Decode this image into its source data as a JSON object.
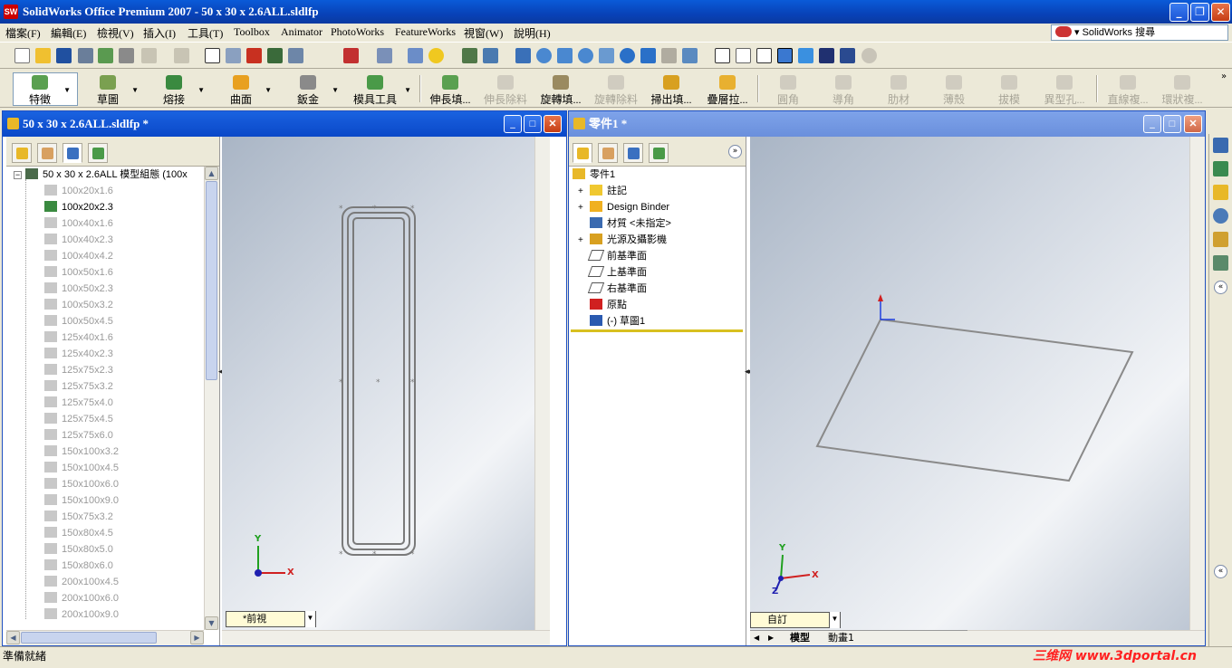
{
  "app": {
    "title": "SolidWorks Office Premium 2007 - 50 x 30 x 2.6ALL.sldlfp",
    "icon_label": "SW"
  },
  "menu": [
    "檔案(F)",
    "編輯(E)",
    "檢視(V)",
    "插入(I)",
    "工具(T)",
    "Toolbox",
    "Animator",
    "PhotoWorks",
    "FeatureWorks",
    "視窗(W)",
    "說明(H)"
  ],
  "search": {
    "label": "SolidWorks 搜尋"
  },
  "command_manager": {
    "groups": [
      "特徵",
      "草圖",
      "熔接",
      "曲面",
      "鈑金",
      "模具工具"
    ],
    "features": [
      {
        "label": "伸長填...",
        "enabled": true
      },
      {
        "label": "伸長除料",
        "enabled": false
      },
      {
        "label": "旋轉填...",
        "enabled": true
      },
      {
        "label": "旋轉除料",
        "enabled": false
      },
      {
        "label": "掃出填...",
        "enabled": true
      },
      {
        "label": "疊層拉...",
        "enabled": true
      },
      {
        "label": "圓角",
        "enabled": false
      },
      {
        "label": "導角",
        "enabled": false
      },
      {
        "label": "肋材",
        "enabled": false
      },
      {
        "label": "薄殼",
        "enabled": false
      },
      {
        "label": "拔模",
        "enabled": false
      },
      {
        "label": "異型孔...",
        "enabled": false
      },
      {
        "label": "直線複...",
        "enabled": false
      },
      {
        "label": "環狀複...",
        "enabled": false
      }
    ]
  },
  "left_doc": {
    "title": "50 x 30 x 2.6ALL.sldlfp *",
    "root": "50 x 30 x 2.6ALL 模型組態 (100x",
    "configs": [
      {
        "name": "100x20x1.6",
        "active": false
      },
      {
        "name": "100x20x2.3",
        "active": true
      },
      {
        "name": "100x40x1.6",
        "active": false
      },
      {
        "name": "100x40x2.3",
        "active": false
      },
      {
        "name": "100x40x4.2",
        "active": false
      },
      {
        "name": "100x50x1.6",
        "active": false
      },
      {
        "name": "100x50x2.3",
        "active": false
      },
      {
        "name": "100x50x3.2",
        "active": false
      },
      {
        "name": "100x50x4.5",
        "active": false
      },
      {
        "name": "125x40x1.6",
        "active": false
      },
      {
        "name": "125x40x2.3",
        "active": false
      },
      {
        "name": "125x75x2.3",
        "active": false
      },
      {
        "name": "125x75x3.2",
        "active": false
      },
      {
        "name": "125x75x4.0",
        "active": false
      },
      {
        "name": "125x75x4.5",
        "active": false
      },
      {
        "name": "125x75x6.0",
        "active": false
      },
      {
        "name": "150x100x3.2",
        "active": false
      },
      {
        "name": "150x100x4.5",
        "active": false
      },
      {
        "name": "150x100x6.0",
        "active": false
      },
      {
        "name": "150x100x9.0",
        "active": false
      },
      {
        "name": "150x75x3.2",
        "active": false
      },
      {
        "name": "150x80x4.5",
        "active": false
      },
      {
        "name": "150x80x5.0",
        "active": false
      },
      {
        "name": "150x80x6.0",
        "active": false
      },
      {
        "name": "200x100x4.5",
        "active": false
      },
      {
        "name": "200x100x6.0",
        "active": false
      },
      {
        "name": "200x100x9.0",
        "active": false
      }
    ],
    "view_tab": "*前視"
  },
  "right_doc": {
    "title": "零件1 *",
    "tree": [
      {
        "label": "零件1",
        "expand": false,
        "icon": "part-icon"
      },
      {
        "label": "註記",
        "expand": true,
        "icon": "annotations-icon"
      },
      {
        "label": "Design Binder",
        "expand": true,
        "icon": "binder-icon"
      },
      {
        "label": "材質 <未指定>",
        "expand": false,
        "icon": "material-icon"
      },
      {
        "label": "光源及攝影機",
        "expand": true,
        "icon": "lights-icon"
      },
      {
        "label": "前基準面",
        "expand": false,
        "icon": "plane-icon"
      },
      {
        "label": "上基準面",
        "expand": false,
        "icon": "plane-icon"
      },
      {
        "label": "右基準面",
        "expand": false,
        "icon": "plane-icon"
      },
      {
        "label": "原點",
        "expand": false,
        "icon": "origin-icon"
      },
      {
        "label": "(-) 草圖1",
        "expand": false,
        "icon": "sketch-icon"
      }
    ],
    "view_tab": "自訂",
    "model_tabs": [
      "模型",
      "動畫1"
    ]
  },
  "triad": {
    "x": "X",
    "y": "Y",
    "z": "Z"
  },
  "status": {
    "text": "準備就緒"
  },
  "watermark": "三维网 www.3dportal.cn"
}
